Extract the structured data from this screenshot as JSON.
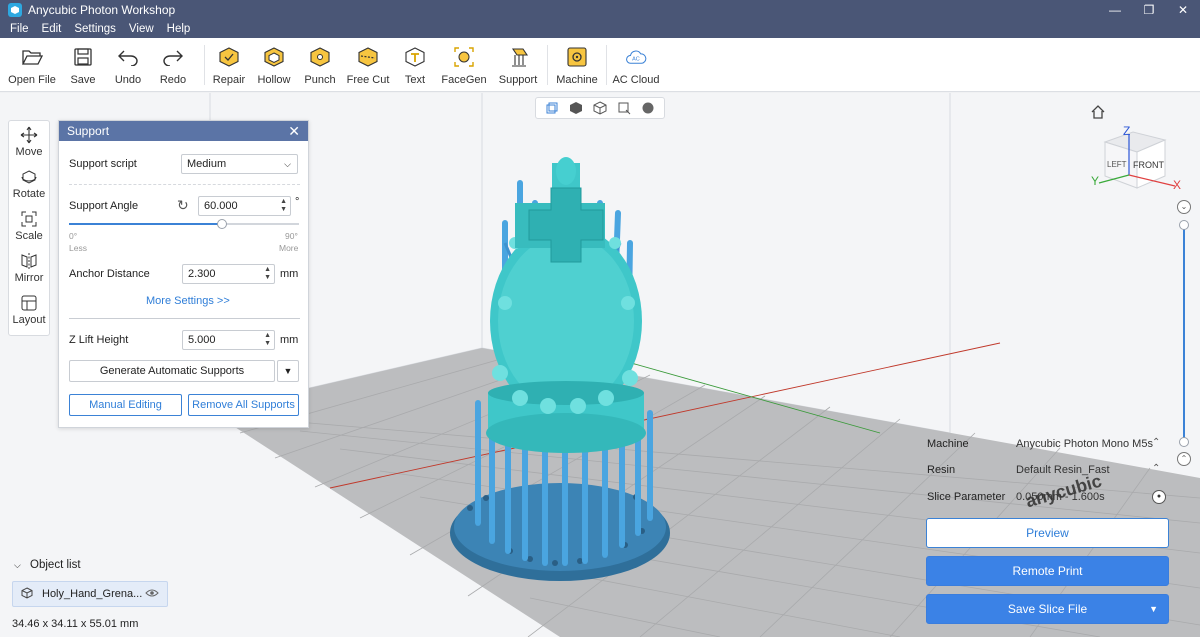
{
  "window": {
    "title": "Anycubic Photon Workshop",
    "controls": [
      "—",
      "❐",
      "✕"
    ]
  },
  "menu": [
    "File",
    "Edit",
    "Settings",
    "View",
    "Help"
  ],
  "toolbar": [
    {
      "label": "Open File",
      "icon": "folder-open-icon"
    },
    {
      "label": "Save",
      "icon": "save-icon"
    },
    {
      "label": "Undo",
      "icon": "undo-icon"
    },
    {
      "label": "Redo",
      "icon": "redo-icon"
    },
    {
      "label": "Repair",
      "icon": "repair-icon"
    },
    {
      "label": "Hollow",
      "icon": "hollow-icon"
    },
    {
      "label": "Punch",
      "icon": "punch-icon"
    },
    {
      "label": "Free Cut",
      "icon": "free-cut-icon"
    },
    {
      "label": "Text",
      "icon": "text-icon"
    },
    {
      "label": "FaceGen",
      "icon": "facegen-icon"
    },
    {
      "label": "Support",
      "icon": "support-icon"
    },
    {
      "label": "Machine",
      "icon": "machine-icon"
    },
    {
      "label": "AC Cloud",
      "icon": "ac-cloud-icon"
    }
  ],
  "left_tools": [
    {
      "label": "Move",
      "icon": "move-icon"
    },
    {
      "label": "Rotate",
      "icon": "rotate-icon"
    },
    {
      "label": "Scale",
      "icon": "scale-icon"
    },
    {
      "label": "Mirror",
      "icon": "mirror-icon"
    },
    {
      "label": "Layout",
      "icon": "layout-icon"
    }
  ],
  "support_panel": {
    "title": "Support",
    "support_script_label": "Support script",
    "support_script_value": "Medium",
    "support_angle_label": "Support Angle",
    "support_angle_value": "60.000",
    "support_angle_unit": "°",
    "angle_fraction": 0.667,
    "angle_min": "0°",
    "angle_min_caption": "Less",
    "angle_max": "90°",
    "angle_max_caption": "More",
    "anchor_label": "Anchor Distance",
    "anchor_value": "2.300",
    "anchor_unit": "mm",
    "more_settings": "More Settings >>",
    "zlift_label": "Z Lift Height",
    "zlift_value": "5.000",
    "zlift_unit": "mm",
    "generate_label": "Generate Automatic Supports",
    "manual_label": "Manual Editing",
    "remove_label": "Remove All Supports"
  },
  "navcube": {
    "top": "Z",
    "left": "LEFT",
    "front": "FRONT",
    "x_axis": "X",
    "y_axis": "Y"
  },
  "slice_info": {
    "machine_label": "Machine",
    "machine_value": "Anycubic Photon Mono M5s",
    "resin_label": "Resin",
    "resin_value": "Default Resin_Fast",
    "slice_label": "Slice Parameter",
    "slice_value": "0.050mm - 1.600s"
  },
  "actions": {
    "preview": "Preview",
    "remote_print": "Remote Print",
    "save_slice": "Save Slice File"
  },
  "object_list": {
    "title": "Object list",
    "item": "Holy_Hand_Grena...",
    "dimensions": "34.46 x 34.11 x 55.01 mm"
  },
  "build_plate_logo": "anycubic",
  "colors": {
    "accent": "#3b82e6",
    "model": "#3fc7c9",
    "supports": "#4aa5e0",
    "title_bar": "#4a5676"
  }
}
